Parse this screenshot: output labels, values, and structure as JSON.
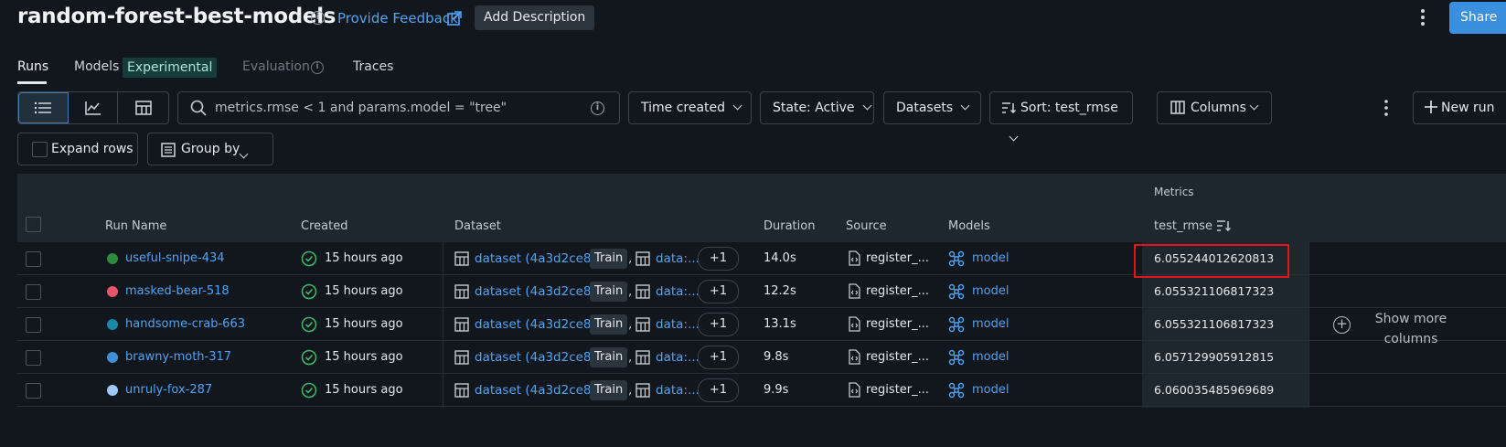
{
  "header": {
    "title": "random-forest-best-models",
    "info_icon": "i",
    "feedback_label": "Provide Feedback",
    "add_description_label": "Add Description",
    "share_label": "Share"
  },
  "tabs": [
    {
      "label": "Runs",
      "active": true
    },
    {
      "label": "Models",
      "badge": "Experimental"
    },
    {
      "label": "Evaluation",
      "disabled": true
    },
    {
      "label": "Traces"
    }
  ],
  "toolbar": {
    "search_value": "metrics.rmse < 1 and params.model = \"tree\"",
    "time_created_label": "Time created",
    "state_label": "State: Active",
    "datasets_label": "Datasets",
    "sort_label": "Sort: test_rmse",
    "columns_label": "Columns",
    "new_run_label": "New run",
    "expand_rows_label": "Expand rows",
    "group_by_label": "Group by"
  },
  "table": {
    "metrics_group_label": "Metrics",
    "columns": {
      "run_name": "Run Name",
      "created": "Created",
      "dataset": "Dataset",
      "duration": "Duration",
      "source": "Source",
      "models": "Models",
      "test_rmse": "test_rmse"
    },
    "rows": [
      {
        "name": "useful-snipe-434",
        "color": "#2e8b3e",
        "created": "15 hours ago",
        "dataset": "dataset (4a3d2ce8)",
        "tag": "Train",
        "dataset2": "data:...",
        "more": "+1",
        "duration": "14.0s",
        "source": "register_...",
        "model": "model",
        "rmse": "6.055244012620813"
      },
      {
        "name": "masked-bear-518",
        "color": "#e5566b",
        "created": "15 hours ago",
        "dataset": "dataset (4a3d2ce8)",
        "tag": "Train",
        "dataset2": "data:...",
        "more": "+1",
        "duration": "12.2s",
        "source": "register_...",
        "model": "model",
        "rmse": "6.055321106817323"
      },
      {
        "name": "handsome-crab-663",
        "color": "#1a86a8",
        "created": "15 hours ago",
        "dataset": "dataset (4a3d2ce8)",
        "tag": "Train",
        "dataset2": "data:...",
        "more": "+1",
        "duration": "13.1s",
        "source": "register_...",
        "model": "model",
        "rmse": "6.055321106817323"
      },
      {
        "name": "brawny-moth-317",
        "color": "#3f8fd6",
        "created": "15 hours ago",
        "dataset": "dataset (4a3d2ce8)",
        "tag": "Train",
        "dataset2": "data:...",
        "more": "+1",
        "duration": "9.8s",
        "source": "register_...",
        "model": "model",
        "rmse": "6.057129905912815"
      },
      {
        "name": "unruly-fox-287",
        "color": "#9fc8f2",
        "created": "15 hours ago",
        "dataset": "dataset (4a3d2ce8)",
        "tag": "Train",
        "dataset2": "data:...",
        "more": "+1",
        "duration": "9.9s",
        "source": "register_...",
        "model": "model",
        "rmse": "6.060035485969689"
      }
    ],
    "show_more_label": "Show more columns",
    "show_more_plus": "+"
  },
  "colors": {
    "background": "#11171c",
    "accent": "#4fa3f5",
    "share": "#3b8fdf",
    "success": "#3fb96a",
    "highlight": "#e0161b"
  }
}
